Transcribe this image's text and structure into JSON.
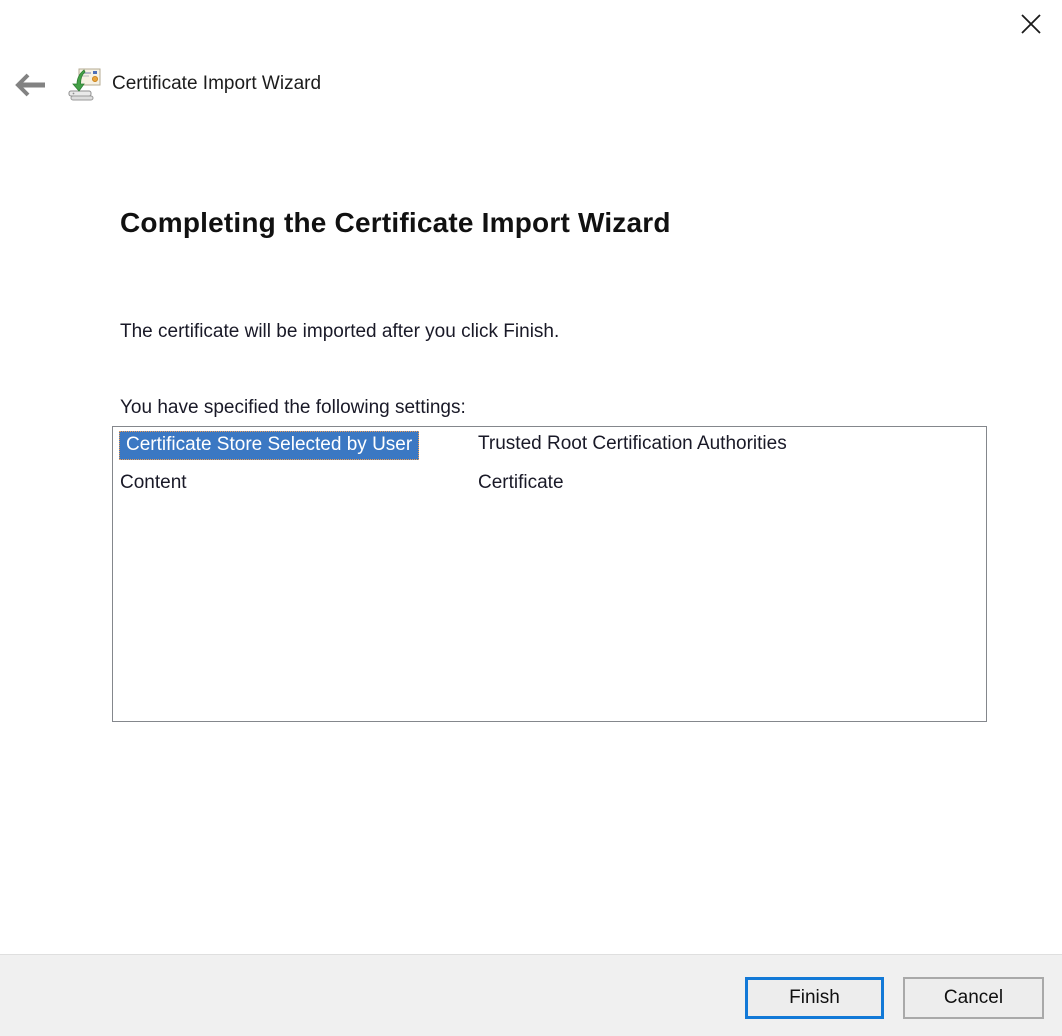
{
  "header": {
    "title": "Certificate Import Wizard",
    "icons": {
      "back": "left-arrow",
      "close": "x-cross",
      "app": "certificate-import-icon"
    }
  },
  "content": {
    "heading": "Completing the Certificate Import Wizard",
    "intro": "The certificate will be imported after you click Finish.",
    "settings_label": "You have specified the following settings:",
    "settings": {
      "rows": [
        {
          "name": "Certificate Store Selected by User",
          "value": "Trusted Root Certification Authorities",
          "selected": true
        },
        {
          "name": "Content",
          "value": "Certificate",
          "selected": false
        }
      ]
    }
  },
  "footer": {
    "finish_label": "Finish",
    "cancel_label": "Cancel"
  },
  "colors": {
    "selection_blue": "#3b78c3",
    "selection_focus_dots": "#ef9e54",
    "accent_button_border": "#1279d7",
    "listbox_border": "#84878c",
    "footer_bg": "#f0f0f0",
    "text": "#191927"
  }
}
